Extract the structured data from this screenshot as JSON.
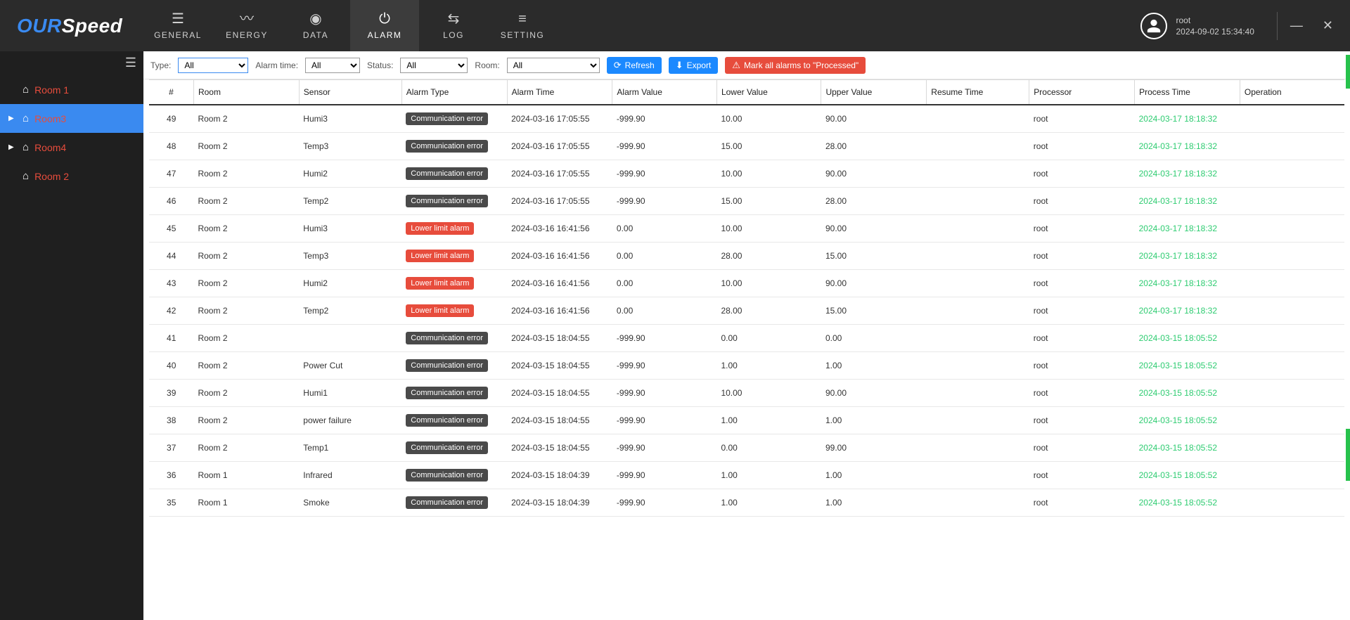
{
  "brand": {
    "part1": "OUR",
    "part2": "Speed"
  },
  "nav": [
    {
      "key": "general",
      "label": "GENERAL",
      "icon": "☰"
    },
    {
      "key": "energy",
      "label": "ENERGY",
      "icon": "〰"
    },
    {
      "key": "data",
      "label": "DATA",
      "icon": "◉"
    },
    {
      "key": "alarm",
      "label": "ALARM",
      "icon": "⏻",
      "active": true
    },
    {
      "key": "log",
      "label": "LOG",
      "icon": "⇆"
    },
    {
      "key": "setting",
      "label": "SETTING",
      "icon": "≡"
    }
  ],
  "user": {
    "name": "root",
    "datetime": "2024-09-02 15:34:40"
  },
  "sidebar": [
    {
      "label": "Room 1",
      "caret": ""
    },
    {
      "label": "Room3",
      "caret": "▶",
      "active": true
    },
    {
      "label": "Room4",
      "caret": "▶"
    },
    {
      "label": "Room 2",
      "caret": ""
    }
  ],
  "filters": {
    "type_label": "Type:",
    "type_value": "All",
    "alarmtime_label": "Alarm time:",
    "alarmtime_value": "All",
    "status_label": "Status:",
    "status_value": "All",
    "room_label": "Room:",
    "room_value": "All"
  },
  "buttons": {
    "refresh": "Refresh",
    "export": "Export",
    "markall": "Mark all alarms to \"Processed\""
  },
  "columns": [
    "#",
    "Room",
    "Sensor",
    "Alarm Type",
    "Alarm Time",
    "Alarm Value",
    "Lower Value",
    "Upper Value",
    "Resume Time",
    "Processor",
    "Process Time",
    "Operation"
  ],
  "rows": [
    {
      "idx": "49",
      "room": "Room 2",
      "sensor": "Humi3",
      "type": "Communication error",
      "type_style": "dark",
      "time": "2024-03-16 17:05:55",
      "val": "-999.90",
      "lo": "10.00",
      "hi": "90.00",
      "resume": "",
      "proc": "root",
      "ptime": "2024-03-17 18:18:32"
    },
    {
      "idx": "48",
      "room": "Room 2",
      "sensor": "Temp3",
      "type": "Communication error",
      "type_style": "dark",
      "time": "2024-03-16 17:05:55",
      "val": "-999.90",
      "lo": "15.00",
      "hi": "28.00",
      "resume": "",
      "proc": "root",
      "ptime": "2024-03-17 18:18:32"
    },
    {
      "idx": "47",
      "room": "Room 2",
      "sensor": "Humi2",
      "type": "Communication error",
      "type_style": "dark",
      "time": "2024-03-16 17:05:55",
      "val": "-999.90",
      "lo": "10.00",
      "hi": "90.00",
      "resume": "",
      "proc": "root",
      "ptime": "2024-03-17 18:18:32"
    },
    {
      "idx": "46",
      "room": "Room 2",
      "sensor": "Temp2",
      "type": "Communication error",
      "type_style": "dark",
      "time": "2024-03-16 17:05:55",
      "val": "-999.90",
      "lo": "15.00",
      "hi": "28.00",
      "resume": "",
      "proc": "root",
      "ptime": "2024-03-17 18:18:32"
    },
    {
      "idx": "45",
      "room": "Room 2",
      "sensor": "Humi3",
      "type": "Lower limit alarm",
      "type_style": "red",
      "time": "2024-03-16 16:41:56",
      "val": "0.00",
      "lo": "10.00",
      "hi": "90.00",
      "resume": "",
      "proc": "root",
      "ptime": "2024-03-17 18:18:32"
    },
    {
      "idx": "44",
      "room": "Room 2",
      "sensor": "Temp3",
      "type": "Lower limit alarm",
      "type_style": "red",
      "time": "2024-03-16 16:41:56",
      "val": "0.00",
      "lo": "28.00",
      "hi": "15.00",
      "resume": "",
      "proc": "root",
      "ptime": "2024-03-17 18:18:32"
    },
    {
      "idx": "43",
      "room": "Room 2",
      "sensor": "Humi2",
      "type": "Lower limit alarm",
      "type_style": "red",
      "time": "2024-03-16 16:41:56",
      "val": "0.00",
      "lo": "10.00",
      "hi": "90.00",
      "resume": "",
      "proc": "root",
      "ptime": "2024-03-17 18:18:32"
    },
    {
      "idx": "42",
      "room": "Room 2",
      "sensor": "Temp2",
      "type": "Lower limit alarm",
      "type_style": "red",
      "time": "2024-03-16 16:41:56",
      "val": "0.00",
      "lo": "28.00",
      "hi": "15.00",
      "resume": "",
      "proc": "root",
      "ptime": "2024-03-17 18:18:32"
    },
    {
      "idx": "41",
      "room": "Room 2",
      "sensor": "",
      "type": "Communication error",
      "type_style": "dark",
      "time": "2024-03-15 18:04:55",
      "val": "-999.90",
      "lo": "0.00",
      "hi": "0.00",
      "resume": "",
      "proc": "root",
      "ptime": "2024-03-15 18:05:52"
    },
    {
      "idx": "40",
      "room": "Room 2",
      "sensor": "Power Cut",
      "type": "Communication error",
      "type_style": "dark",
      "time": "2024-03-15 18:04:55",
      "val": "-999.90",
      "lo": "1.00",
      "hi": "1.00",
      "resume": "",
      "proc": "root",
      "ptime": "2024-03-15 18:05:52"
    },
    {
      "idx": "39",
      "room": "Room 2",
      "sensor": "Humi1",
      "type": "Communication error",
      "type_style": "dark",
      "time": "2024-03-15 18:04:55",
      "val": "-999.90",
      "lo": "10.00",
      "hi": "90.00",
      "resume": "",
      "proc": "root",
      "ptime": "2024-03-15 18:05:52"
    },
    {
      "idx": "38",
      "room": "Room 2",
      "sensor": "power failure",
      "type": "Communication error",
      "type_style": "dark",
      "time": "2024-03-15 18:04:55",
      "val": "-999.90",
      "lo": "1.00",
      "hi": "1.00",
      "resume": "",
      "proc": "root",
      "ptime": "2024-03-15 18:05:52"
    },
    {
      "idx": "37",
      "room": "Room 2",
      "sensor": "Temp1",
      "type": "Communication error",
      "type_style": "dark",
      "time": "2024-03-15 18:04:55",
      "val": "-999.90",
      "lo": "0.00",
      "hi": "99.00",
      "resume": "",
      "proc": "root",
      "ptime": "2024-03-15 18:05:52"
    },
    {
      "idx": "36",
      "room": "Room 1",
      "sensor": "Infrared",
      "type": "Communication error",
      "type_style": "dark",
      "time": "2024-03-15 18:04:39",
      "val": "-999.90",
      "lo": "1.00",
      "hi": "1.00",
      "resume": "",
      "proc": "root",
      "ptime": "2024-03-15 18:05:52"
    },
    {
      "idx": "35",
      "room": "Room 1",
      "sensor": "Smoke",
      "type": "Communication error",
      "type_style": "dark",
      "time": "2024-03-15 18:04:39",
      "val": "-999.90",
      "lo": "1.00",
      "hi": "1.00",
      "resume": "",
      "proc": "root",
      "ptime": "2024-03-15 18:05:52"
    }
  ]
}
